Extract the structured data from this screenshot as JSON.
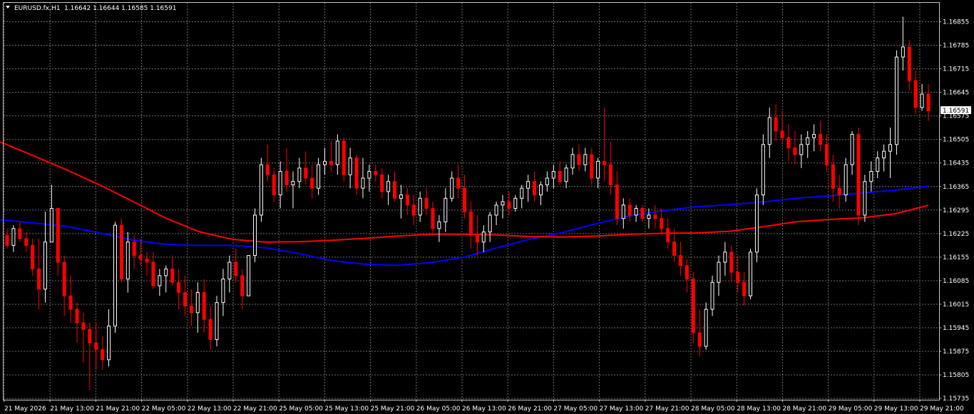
{
  "header": {
    "symbol": "EURUSD.fx,H1",
    "ohlc": "1.16642 1.16644 1.16585 1.16591"
  },
  "colors": {
    "background": "#000000",
    "grid": "#6e6e6e",
    "frame": "#c8c8c8",
    "bull_candle": "#ffffff",
    "bear_candle": "#ff0000",
    "ma_fast": "#0000ff",
    "ma_slow": "#ff0000"
  },
  "chart_data": {
    "type": "candlestick",
    "grid": true,
    "current_price": "1.16591",
    "ylim": [
      1.1574,
      1.1689
    ],
    "y_ticks": [
      "1.16855",
      "1.16785",
      "1.16715",
      "1.16645",
      "1.16575",
      "1.16505",
      "1.16435",
      "1.16365",
      "1.16295",
      "1.16225",
      "1.16155",
      "1.16085",
      "1.16015",
      "1.15945",
      "1.15875",
      "1.15805",
      "1.15735"
    ],
    "x_ticks": [
      "21 May 2026",
      "21 May 13:00",
      "21 May 21:00",
      "22 May 05:00",
      "22 May 13:00",
      "22 May 21:00",
      "25 May 05:00",
      "25 May 13:00",
      "25 May 21:00",
      "26 May 05:00",
      "26 May 13:00",
      "26 May 21:00",
      "27 May 05:00",
      "27 May 13:00",
      "27 May 21:00",
      "28 May 05:00",
      "28 May 13:00",
      "28 May 21:00",
      "29 May 05:00",
      "29 May 13:00",
      "29 May 21:00"
    ],
    "candles": [
      [
        1.1622,
        1.1624,
        1.1618,
        1.1619
      ],
      [
        1.1619,
        1.1625,
        1.1617,
        1.1624
      ],
      [
        1.1624,
        1.1626,
        1.162,
        1.1621
      ],
      [
        1.1621,
        1.1623,
        1.1617,
        1.1619
      ],
      [
        1.1619,
        1.1621,
        1.161,
        1.1612
      ],
      [
        1.1612,
        1.1621,
        1.16,
        1.1606
      ],
      [
        1.1606,
        1.1629,
        1.1602,
        1.162
      ],
      [
        1.162,
        1.1637,
        1.162,
        1.163
      ],
      [
        1.163,
        1.163,
        1.161,
        1.1614
      ],
      [
        1.1614,
        1.1616,
        1.1598,
        1.1604
      ],
      [
        1.1604,
        1.161,
        1.1596,
        1.16
      ],
      [
        1.16,
        1.1602,
        1.159,
        1.1596
      ],
      [
        1.1596,
        1.1599,
        1.1584,
        1.1594
      ],
      [
        1.1594,
        1.1596,
        1.1576,
        1.159
      ],
      [
        1.159,
        1.1596,
        1.1582,
        1.1588
      ],
      [
        1.1588,
        1.1592,
        1.1582,
        1.1585
      ],
      [
        1.1585,
        1.16,
        1.1583,
        1.1595
      ],
      [
        1.1595,
        1.1626,
        1.1593,
        1.1625
      ],
      [
        1.1625,
        1.1627,
        1.1608,
        1.1609
      ],
      [
        1.1609,
        1.1623,
        1.1605,
        1.162
      ],
      [
        1.162,
        1.1622,
        1.1612,
        1.1616
      ],
      [
        1.1616,
        1.1621,
        1.1613,
        1.1615
      ],
      [
        1.1615,
        1.1617,
        1.161,
        1.1614
      ],
      [
        1.1614,
        1.1617,
        1.1606,
        1.1607
      ],
      [
        1.1607,
        1.1612,
        1.1604,
        1.161
      ],
      [
        1.161,
        1.1613,
        1.1605,
        1.1612
      ],
      [
        1.1612,
        1.1616,
        1.1607,
        1.1608
      ],
      [
        1.1608,
        1.1612,
        1.16,
        1.1605
      ],
      [
        1.1605,
        1.161,
        1.1598,
        1.1601
      ],
      [
        1.1601,
        1.1606,
        1.1595,
        1.1599
      ],
      [
        1.1599,
        1.1608,
        1.1593,
        1.1605
      ],
      [
        1.1605,
        1.1609,
        1.1593,
        1.1597
      ],
      [
        1.1597,
        1.1601,
        1.1588,
        1.1591
      ],
      [
        1.1591,
        1.1604,
        1.1589,
        1.1602
      ],
      [
        1.1602,
        1.1612,
        1.1598,
        1.1609
      ],
      [
        1.1609,
        1.1616,
        1.1605,
        1.1614
      ],
      [
        1.1614,
        1.1618,
        1.1608,
        1.161
      ],
      [
        1.161,
        1.1612,
        1.16,
        1.1604
      ],
      [
        1.1604,
        1.1616,
        1.1604,
        1.1616
      ],
      [
        1.1616,
        1.163,
        1.1614,
        1.1628
      ],
      [
        1.1628,
        1.1645,
        1.1626,
        1.1643
      ],
      [
        1.1643,
        1.1649,
        1.1638,
        1.164
      ],
      [
        1.164,
        1.1642,
        1.1632,
        1.1634
      ],
      [
        1.1634,
        1.1644,
        1.163,
        1.1641
      ],
      [
        1.1641,
        1.1648,
        1.1635,
        1.1637
      ],
      [
        1.1637,
        1.1641,
        1.163,
        1.1638
      ],
      [
        1.1638,
        1.1645,
        1.1636,
        1.1642
      ],
      [
        1.1642,
        1.1647,
        1.1637,
        1.1639
      ],
      [
        1.1639,
        1.1643,
        1.1633,
        1.1636
      ],
      [
        1.1636,
        1.1645,
        1.1634,
        1.1643
      ],
      [
        1.1643,
        1.1648,
        1.164,
        1.1644
      ],
      [
        1.1644,
        1.165,
        1.1641,
        1.1643
      ],
      [
        1.1643,
        1.1652,
        1.164,
        1.165
      ],
      [
        1.165,
        1.1651,
        1.1638,
        1.164
      ],
      [
        1.164,
        1.1648,
        1.1636,
        1.1645
      ],
      [
        1.1645,
        1.1646,
        1.1634,
        1.1636
      ],
      [
        1.1636,
        1.1645,
        1.1633,
        1.1639
      ],
      [
        1.1639,
        1.1643,
        1.1635,
        1.1641
      ],
      [
        1.1641,
        1.1643,
        1.1638,
        1.164
      ],
      [
        1.164,
        1.1642,
        1.1633,
        1.1635
      ],
      [
        1.1635,
        1.164,
        1.1631,
        1.1638
      ],
      [
        1.1638,
        1.1641,
        1.1632,
        1.1633
      ],
      [
        1.1633,
        1.1637,
        1.1627,
        1.1634
      ],
      [
        1.1634,
        1.1636,
        1.1628,
        1.1631
      ],
      [
        1.1631,
        1.1634,
        1.1625,
        1.1628
      ],
      [
        1.1628,
        1.1635,
        1.1626,
        1.1633
      ],
      [
        1.1633,
        1.1636,
        1.1628,
        1.163
      ],
      [
        1.163,
        1.1632,
        1.1622,
        1.1624
      ],
      [
        1.1624,
        1.1628,
        1.162,
        1.1626
      ],
      [
        1.1626,
        1.1636,
        1.1623,
        1.1633
      ],
      [
        1.1633,
        1.1641,
        1.1632,
        1.1639
      ],
      [
        1.1639,
        1.1643,
        1.1633,
        1.1636
      ],
      [
        1.1636,
        1.164,
        1.1627,
        1.1629
      ],
      [
        1.1629,
        1.1632,
        1.1618,
        1.1622
      ],
      [
        1.1622,
        1.1628,
        1.1616,
        1.162
      ],
      [
        1.162,
        1.1625,
        1.1617,
        1.1623
      ],
      [
        1.1623,
        1.1629,
        1.162,
        1.1628
      ],
      [
        1.1628,
        1.1632,
        1.1625,
        1.1631
      ],
      [
        1.1631,
        1.1634,
        1.1627,
        1.1632
      ],
      [
        1.1632,
        1.1635,
        1.1628,
        1.163
      ],
      [
        1.163,
        1.1634,
        1.1629,
        1.1633
      ],
      [
        1.1633,
        1.1637,
        1.163,
        1.1636
      ],
      [
        1.1636,
        1.164,
        1.1632,
        1.1638
      ],
      [
        1.1638,
        1.1641,
        1.1632,
        1.1634
      ],
      [
        1.1634,
        1.1638,
        1.1631,
        1.1637
      ],
      [
        1.1637,
        1.1641,
        1.1635,
        1.1639
      ],
      [
        1.1639,
        1.1643,
        1.1636,
        1.1641
      ],
      [
        1.1641,
        1.1644,
        1.1637,
        1.1638
      ],
      [
        1.1638,
        1.1643,
        1.1636,
        1.1642
      ],
      [
        1.1642,
        1.1648,
        1.164,
        1.1646
      ],
      [
        1.1646,
        1.1649,
        1.1641,
        1.1643
      ],
      [
        1.1643,
        1.1648,
        1.1641,
        1.1646
      ],
      [
        1.1646,
        1.1648,
        1.1637,
        1.1639
      ],
      [
        1.1639,
        1.1645,
        1.1636,
        1.1644
      ],
      [
        1.1644,
        1.166,
        1.1638,
        1.1643
      ],
      [
        1.1643,
        1.165,
        1.1634,
        1.1637
      ],
      [
        1.1637,
        1.1641,
        1.1625,
        1.1627
      ],
      [
        1.1627,
        1.1633,
        1.1624,
        1.1631
      ],
      [
        1.1631,
        1.1633,
        1.1626,
        1.1628
      ],
      [
        1.1628,
        1.1631,
        1.1626,
        1.163
      ],
      [
        1.163,
        1.1631,
        1.1626,
        1.1627
      ],
      [
        1.1627,
        1.163,
        1.1624,
        1.1628
      ],
      [
        1.1628,
        1.1631,
        1.1624,
        1.1627
      ],
      [
        1.1627,
        1.163,
        1.1622,
        1.1624
      ],
      [
        1.1624,
        1.1627,
        1.1618,
        1.162
      ],
      [
        1.162,
        1.1624,
        1.1614,
        1.1616
      ],
      [
        1.1616,
        1.162,
        1.161,
        1.1613
      ],
      [
        1.1613,
        1.1615,
        1.1605,
        1.1609
      ],
      [
        1.1609,
        1.1611,
        1.159,
        1.1593
      ],
      [
        1.1593,
        1.16,
        1.1586,
        1.1589
      ],
      [
        1.1589,
        1.1602,
        1.1588,
        1.16
      ],
      [
        1.16,
        1.161,
        1.1598,
        1.1608
      ],
      [
        1.1608,
        1.1616,
        1.1604,
        1.1614
      ],
      [
        1.1614,
        1.162,
        1.161,
        1.1617
      ],
      [
        1.1617,
        1.1619,
        1.1608,
        1.1611
      ],
      [
        1.1611,
        1.1616,
        1.1605,
        1.1608
      ],
      [
        1.1608,
        1.1611,
        1.1601,
        1.1604
      ],
      [
        1.1604,
        1.1618,
        1.1603,
        1.1617
      ],
      [
        1.1617,
        1.1636,
        1.1614,
        1.1634
      ],
      [
        1.1634,
        1.1652,
        1.1631,
        1.1649
      ],
      [
        1.1649,
        1.166,
        1.1645,
        1.1657
      ],
      [
        1.1657,
        1.1661,
        1.165,
        1.1653
      ],
      [
        1.1653,
        1.1659,
        1.1649,
        1.1651
      ],
      [
        1.1651,
        1.1655,
        1.1644,
        1.1648
      ],
      [
        1.1648,
        1.1653,
        1.1643,
        1.1646
      ],
      [
        1.1646,
        1.1652,
        1.1642,
        1.1649
      ],
      [
        1.1649,
        1.1653,
        1.1645,
        1.1651
      ],
      [
        1.1651,
        1.1655,
        1.1647,
        1.1652
      ],
      [
        1.1652,
        1.1656,
        1.1647,
        1.1649
      ],
      [
        1.1649,
        1.1652,
        1.1641,
        1.1643
      ],
      [
        1.1643,
        1.1646,
        1.1632,
        1.1636
      ],
      [
        1.1636,
        1.164,
        1.163,
        1.1634
      ],
      [
        1.1634,
        1.1645,
        1.1632,
        1.1643
      ],
      [
        1.1643,
        1.1653,
        1.164,
        1.1652
      ],
      [
        1.1652,
        1.1654,
        1.1625,
        1.1628
      ],
      [
        1.1628,
        1.164,
        1.1626,
        1.1638
      ],
      [
        1.1638,
        1.1644,
        1.1635,
        1.1641
      ],
      [
        1.1641,
        1.1647,
        1.1639,
        1.1645
      ],
      [
        1.1645,
        1.1649,
        1.1641,
        1.1647
      ],
      [
        1.1647,
        1.1654,
        1.1639,
        1.1649
      ],
      [
        1.1649,
        1.1677,
        1.1646,
        1.1675
      ],
      [
        1.1675,
        1.1687,
        1.1671,
        1.1678
      ],
      [
        1.1678,
        1.168,
        1.1665,
        1.1668
      ],
      [
        1.1668,
        1.1671,
        1.1658,
        1.166
      ],
      [
        1.166,
        1.1667,
        1.1659,
        1.1664
      ],
      [
        1.1664,
        1.1667,
        1.1656,
        1.1659
      ]
    ],
    "moving_averages": [
      {
        "color": "ma_fast",
        "values": [
          1.16266,
          1.16257,
          1.16247,
          1.16227,
          1.16206,
          1.16193,
          1.1619,
          1.1619,
          1.16183,
          1.16166,
          1.16145,
          1.16134,
          1.16131,
          1.16139,
          1.16155,
          1.16183,
          1.16209,
          1.16229,
          1.16255,
          1.16278,
          1.16293,
          1.16305,
          1.16311,
          1.16319,
          1.1633,
          1.16337,
          1.16346,
          1.16354,
          1.16366
        ]
      },
      {
        "color": "ma_slow",
        "values": [
          1.16498,
          1.16457,
          1.16415,
          1.1637,
          1.16321,
          1.16271,
          1.16231,
          1.16208,
          1.162,
          1.16201,
          1.16205,
          1.16211,
          1.16218,
          1.16223,
          1.16223,
          1.16221,
          1.16216,
          1.16215,
          1.16218,
          1.16223,
          1.16226,
          1.16227,
          1.16232,
          1.16245,
          1.1626,
          1.16267,
          1.16272,
          1.16284,
          1.16309
        ]
      }
    ]
  }
}
